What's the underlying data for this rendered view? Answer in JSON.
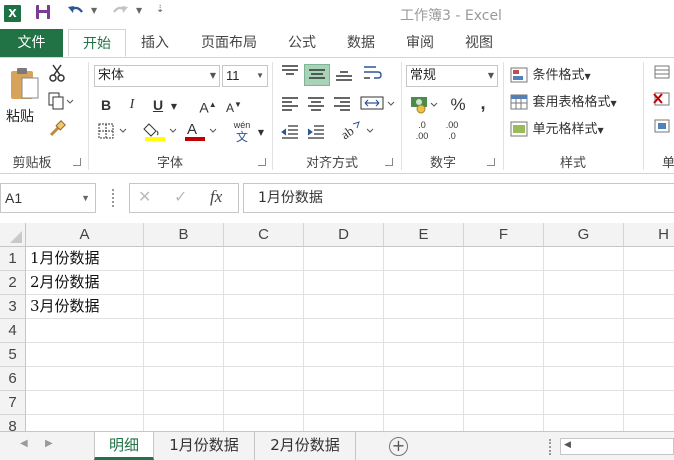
{
  "window": {
    "app_icon": "X",
    "title": "工作簿3 - Excel"
  },
  "quick_access": {
    "save_icon": "save-icon",
    "undo_icon": "undo-icon",
    "redo_icon": "redo-icon",
    "customize_icon": "customize-icon"
  },
  "ribbon_tabs": {
    "file": "文件",
    "items": [
      "开始",
      "插入",
      "页面布局",
      "公式",
      "数据",
      "审阅",
      "视图"
    ],
    "active": "开始"
  },
  "ribbon": {
    "clipboard": {
      "label": "剪贴板",
      "paste": "粘贴"
    },
    "font": {
      "label": "字体",
      "name": "宋体",
      "size": "11",
      "bold": "B",
      "italic": "I",
      "underline": "U",
      "grow": "A",
      "shrink": "A",
      "phonetic_top": "wén",
      "phonetic_bottom": "文",
      "fill_color": "#ffff00",
      "font_color": "#c00000"
    },
    "alignment": {
      "label": "对齐方式"
    },
    "number": {
      "label": "数字",
      "format": "常规",
      "percent": "%",
      "comma": ",",
      "inc_decimal_top": ".0",
      "inc_decimal_bottom": ".00",
      "dec_decimal_top": ".00",
      "dec_decimal_bottom": ".0"
    },
    "styles": {
      "label": "样式",
      "conditional": "条件格式",
      "table_format": "套用表格格式",
      "cell_styles": "单元格样式"
    },
    "cells": {
      "label": "单"
    }
  },
  "formula_bar": {
    "name_box": "A1",
    "cancel": "✕",
    "enter": "✓",
    "fx": "fx",
    "content": "1月份数据"
  },
  "grid": {
    "columns": [
      "A",
      "B",
      "C",
      "D",
      "E",
      "F",
      "G",
      "H"
    ],
    "rows": [
      "1",
      "2",
      "3",
      "4",
      "5",
      "6",
      "7",
      "8"
    ],
    "cells": {
      "A1": "1月份数据",
      "A2": "2月份数据",
      "A3": "3月份数据"
    }
  },
  "sheets": {
    "items": [
      "明细",
      "1月份数据",
      "2月份数据"
    ],
    "active": "明细",
    "add": "+"
  },
  "colors": {
    "accent": "#217346",
    "selected_button": "#a8d3b8"
  }
}
